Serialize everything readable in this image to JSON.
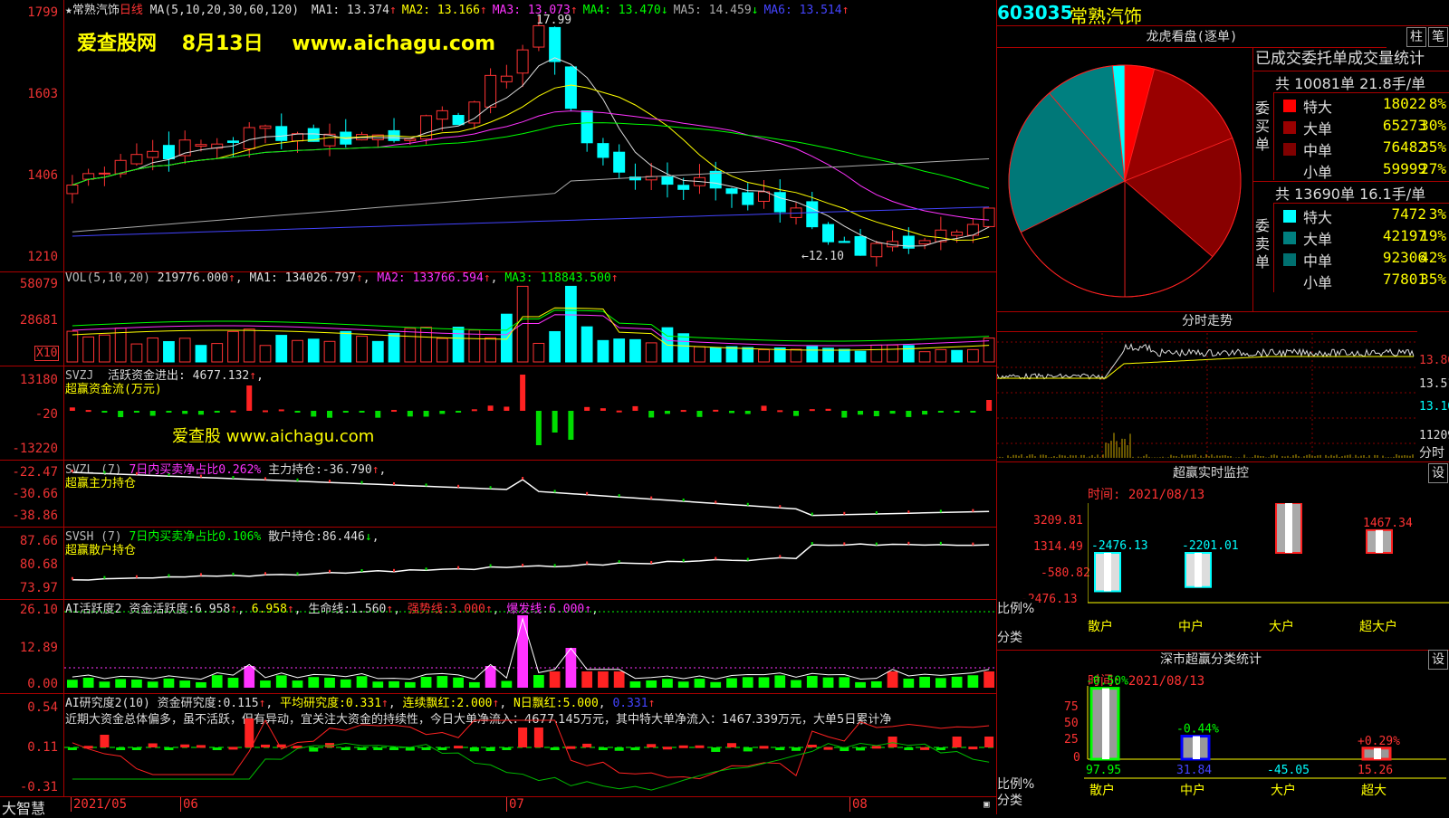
{
  "watermark": {
    "site": "爱查股网",
    "date": "8月13日",
    "url": "www.aichagu.com",
    "url2": "爱查股 www.aichagu.com"
  },
  "kline": {
    "name": "★常熟汽饰",
    "period": "日线",
    "ma_label": "MA(5,10,20,30,60,120)",
    "ma": [
      {
        "k": "MA1",
        "v": "13.374",
        "arrow": "↑",
        "color": "#dddddd"
      },
      {
        "k": "MA2",
        "v": "13.166",
        "arrow": "↑",
        "color": "#ffff00"
      },
      {
        "k": "MA3",
        "v": "13.073",
        "arrow": "↑",
        "color": "#ff33ff"
      },
      {
        "k": "MA4",
        "v": "13.470",
        "arrow": "↓",
        "color": "#00ff00"
      },
      {
        "k": "MA5",
        "v": "14.459",
        "arrow": "↓",
        "color": "#aaaaaa"
      },
      {
        "k": "MA6",
        "v": "13.514",
        "arrow": "↑",
        "color": "#4444ff"
      }
    ],
    "y_labels": [
      "1799",
      "1603",
      "1406",
      "1210"
    ],
    "high_mark": "17.99",
    "low_mark": "←12.10"
  },
  "vol": {
    "header": "VOL(5,10,20)",
    "value": "219776.000",
    "ma1": "134026.797",
    "ma2": "133766.594",
    "ma3": "118843.500",
    "y_labels": [
      "58079",
      "28681"
    ],
    "unit": "X10"
  },
  "svzj": {
    "header": "SVZJ",
    "t1": "活跃资金进出:",
    "v1": "4677.132",
    "t2": "超赢资金流(万元)",
    "y_labels": [
      "13180",
      "-20",
      "-13220"
    ]
  },
  "svzl": {
    "header": "SVZL (7)",
    "t1": "7日内买卖净占比0.262%",
    "t2": "主力持仓:",
    "v2": "-36.790",
    "t3": "超赢主力持仓",
    "y_labels": [
      "-22.47",
      "-30.66",
      "-38.86"
    ]
  },
  "svsh": {
    "header": "SVSH (7)",
    "t1": "7日内买卖净占比0.106%",
    "t2": "散户持仓:",
    "v2": "86.446",
    "t3": "超赢散户持仓",
    "y_labels": [
      "87.66",
      "80.68",
      "73.97"
    ]
  },
  "ai1": {
    "header": "AI活跃度2",
    "t1": "资金活跃度:",
    "v1": "6.958",
    "v2": "6.958",
    "t3": "生命线:",
    "v3": "1.560",
    "t4": "强势线:",
    "v4": "3.000",
    "t5": "爆发线:",
    "v5": "6.000",
    "y_labels": [
      "26.10",
      "12.89",
      "0.00"
    ]
  },
  "ai2": {
    "header": "AI研究度2(10)",
    "t1": "资金研究度:",
    "v1": "0.115",
    "t2": "平均研究度:",
    "v2": "0.331",
    "t3": "连续飘红:",
    "v3": "2.000",
    "t4": "N日飘红:",
    "v4": "5.000",
    "v5": "0.331",
    "comment": "近期大资金总体偏多，虽不活跃，但有异动，宜关注大资金的持续性，今日大单净流入：4677.145万元，其中特大单净流入：1467.339万元，大单5日累计净",
    "y_labels": [
      "0.54",
      "0.11",
      "-0.31"
    ]
  },
  "timeaxis": {
    "brand": "大智慧",
    "labels": [
      "2021/05",
      "06",
      "07",
      "08"
    ]
  },
  "stock": {
    "code": "603035",
    "name": "常熟汽饰"
  },
  "lhb": {
    "title": "龙虎看盘(逐单)",
    "btn1": "柱",
    "btn2": "笔",
    "table_title": "已成交委托单成交量统计",
    "buy": {
      "side": "委买单",
      "summary": "共 10081单 21.8手/单",
      "rows": [
        {
          "label": "特大",
          "vol": "18022",
          "pct": "8%",
          "color": "#ff0000"
        },
        {
          "label": "大单",
          "vol": "65273",
          "pct": "30%",
          "color": "#990000"
        },
        {
          "label": "中单",
          "vol": "76482",
          "pct": "35%",
          "color": "#800000"
        },
        {
          "label": "小单",
          "vol": "59999",
          "pct": "27%",
          "color": "#000000"
        }
      ]
    },
    "sell": {
      "side": "委卖单",
      "summary": "共 13690单 16.1手/单",
      "rows": [
        {
          "label": "特大",
          "vol": "7472",
          "pct": "3%",
          "color": "#00ffff"
        },
        {
          "label": "大单",
          "vol": "42197",
          "pct": "19%",
          "color": "#008080"
        },
        {
          "label": "中单",
          "vol": "92306",
          "pct": "42%",
          "color": "#007070"
        },
        {
          "label": "小单",
          "vol": "77801",
          "pct": "35%",
          "color": "#000000"
        }
      ]
    }
  },
  "intraday": {
    "title": "分时走势",
    "y_labels": [
      "13.86",
      "13.51",
      "13.16",
      "11209"
    ],
    "unit": "分时"
  },
  "monitor": {
    "title": "超赢实时监控",
    "btn": "设",
    "time": "时间: 2021/08/13",
    "y_labels": [
      "3209.81",
      "1314.49",
      "-580.82",
      "-2476.13"
    ],
    "left_labels": [
      "比例%",
      "分类"
    ],
    "bars": [
      {
        "cat": "散户",
        "value": "-2476.13"
      },
      {
        "cat": "中户",
        "value": "-2201.01"
      },
      {
        "cat": "大户",
        "value": "3209.81"
      },
      {
        "cat": "超大户",
        "value": "1467.34"
      }
    ]
  },
  "classify": {
    "title": "深市超赢分类统计",
    "btn": "设",
    "time": "时间: 2021/08/13",
    "y_labels": [
      "75",
      "50",
      "25",
      "0"
    ],
    "left_labels": [
      "比例%",
      "分类"
    ],
    "bars": [
      {
        "cat": "散户",
        "top": "-0.50%",
        "bottom": "97.95",
        "fill": 0.9795
      },
      {
        "cat": "中户",
        "top": "-0.44%",
        "bottom": "31.84",
        "fill": 0.3184
      },
      {
        "cat": "大户",
        "top": "",
        "bottom": "-45.05",
        "fill": 0
      },
      {
        "cat": "超大",
        "top": "+0.29%",
        "bottom": "15.26",
        "fill": 0.1526
      }
    ]
  }
}
